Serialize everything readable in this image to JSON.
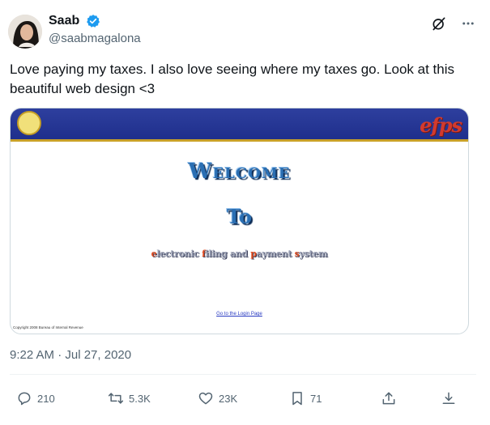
{
  "author": {
    "display_name": "Saab",
    "handle": "@saabmagalona",
    "verified": true
  },
  "tweet": {
    "text": "Love paying my taxes. I also love seeing where my taxes go. Look at this beautiful web design <3",
    "timestamp": "9:22 AM · Jul 27, 2020"
  },
  "embedded_page": {
    "logo_text": "efps",
    "welcome": "Welcome",
    "to": "To",
    "fullname_parts": [
      "e",
      "lectronic ",
      "f",
      "iling and ",
      "p",
      "ayment ",
      "s",
      "ystem"
    ],
    "login_link": "Go to the Login Page",
    "copyright": "Copyright 2008 Bureau of Internal Revenue"
  },
  "metrics": {
    "replies": "210",
    "reposts": "5.3K",
    "likes": "23K",
    "bookmarks": "71"
  },
  "icons": {
    "header": [
      "grok-icon",
      "more-icon"
    ],
    "actions": [
      "reply-icon",
      "repost-icon",
      "like-icon",
      "bookmark-icon",
      "share-icon",
      "download-icon"
    ]
  },
  "colors": {
    "verified": "#1d9bf0",
    "text": "#0f1419",
    "muted": "#536471",
    "efps_blue": "#2b6fb3",
    "efps_banner": "#1f2f8c"
  }
}
